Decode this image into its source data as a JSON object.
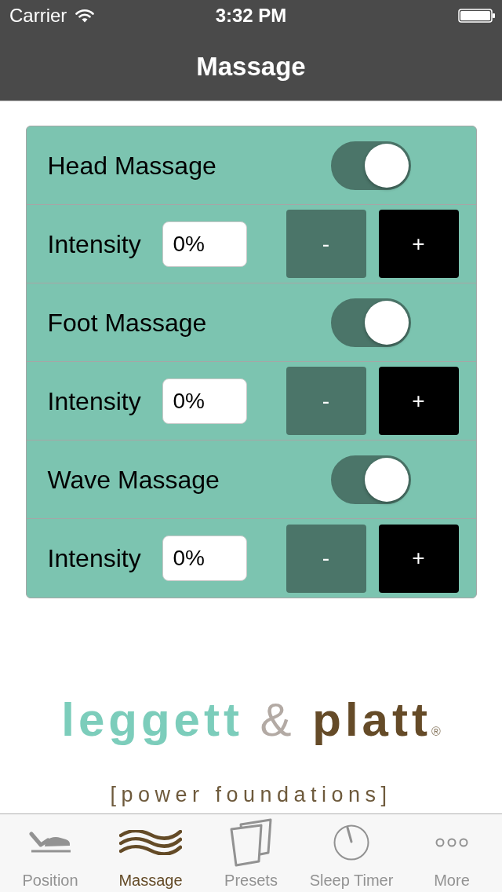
{
  "status_bar": {
    "carrier": "Carrier",
    "time": "3:32 PM"
  },
  "nav_bar": {
    "title": "Massage"
  },
  "massage_panel": {
    "sections": [
      {
        "label": "Head Massage",
        "on": true,
        "intensity": {
          "label": "Intensity",
          "value": "0%",
          "decrease": "-",
          "increase": "+"
        }
      },
      {
        "label": "Foot Massage",
        "on": true,
        "intensity": {
          "label": "Intensity",
          "value": "0%",
          "decrease": "-",
          "increase": "+"
        }
      },
      {
        "label": "Wave Massage",
        "on": true,
        "intensity": {
          "label": "Intensity",
          "value": "0%",
          "decrease": "-",
          "increase": "+"
        }
      }
    ]
  },
  "logo": {
    "words": [
      "leggett",
      "&",
      "platt"
    ],
    "registered_mark": "®",
    "tagline": "[power foundations]"
  },
  "tab_bar": {
    "tabs": [
      {
        "label": "Position",
        "selected": false
      },
      {
        "label": "Massage",
        "selected": true
      },
      {
        "label": "Presets",
        "selected": false
      },
      {
        "label": "Sleep Timer",
        "selected": false
      },
      {
        "label": "More",
        "selected": false
      }
    ]
  }
}
